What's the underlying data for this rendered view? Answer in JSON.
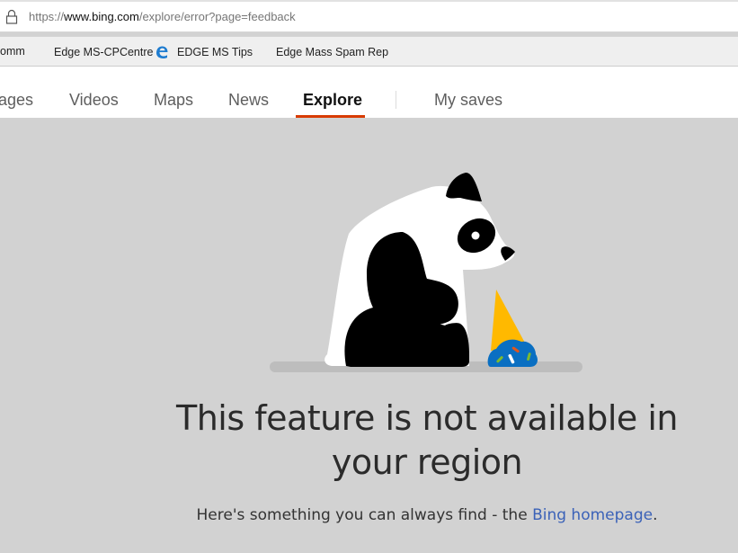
{
  "browser": {
    "url": {
      "scheme": "https://",
      "host": "www.bing.com",
      "path": "/explore/error?page=feedback"
    },
    "favorites": [
      {
        "label": "omm",
        "icon": "truncated"
      },
      {
        "label": "Edge MS-CPCentre",
        "icon": "microsoft-logo-icon"
      },
      {
        "label": "EDGE MS Tips",
        "icon": "edge-logo-icon"
      },
      {
        "label": "Edge Mass Spam Rep",
        "icon": "microsoft-logo-icon"
      }
    ]
  },
  "nav": {
    "tabs": [
      {
        "label": "ages"
      },
      {
        "label": "Videos"
      },
      {
        "label": "Maps"
      },
      {
        "label": "News"
      },
      {
        "label": "Explore",
        "active": true
      },
      {
        "label": "My saves"
      }
    ],
    "accent": "#d83b01"
  },
  "error": {
    "illustration": "sad-panda-dropped-ice-cream",
    "headline": "This feature is not available in your region",
    "sub_prefix": "Here's something you can always find - the ",
    "sub_link": "Bing homepage",
    "sub_suffix": "."
  },
  "colors": {
    "background": "#d2d2d2",
    "link": "#3b62b8",
    "cone": "#ffb900",
    "ice_cream": "#0a6fc2"
  }
}
